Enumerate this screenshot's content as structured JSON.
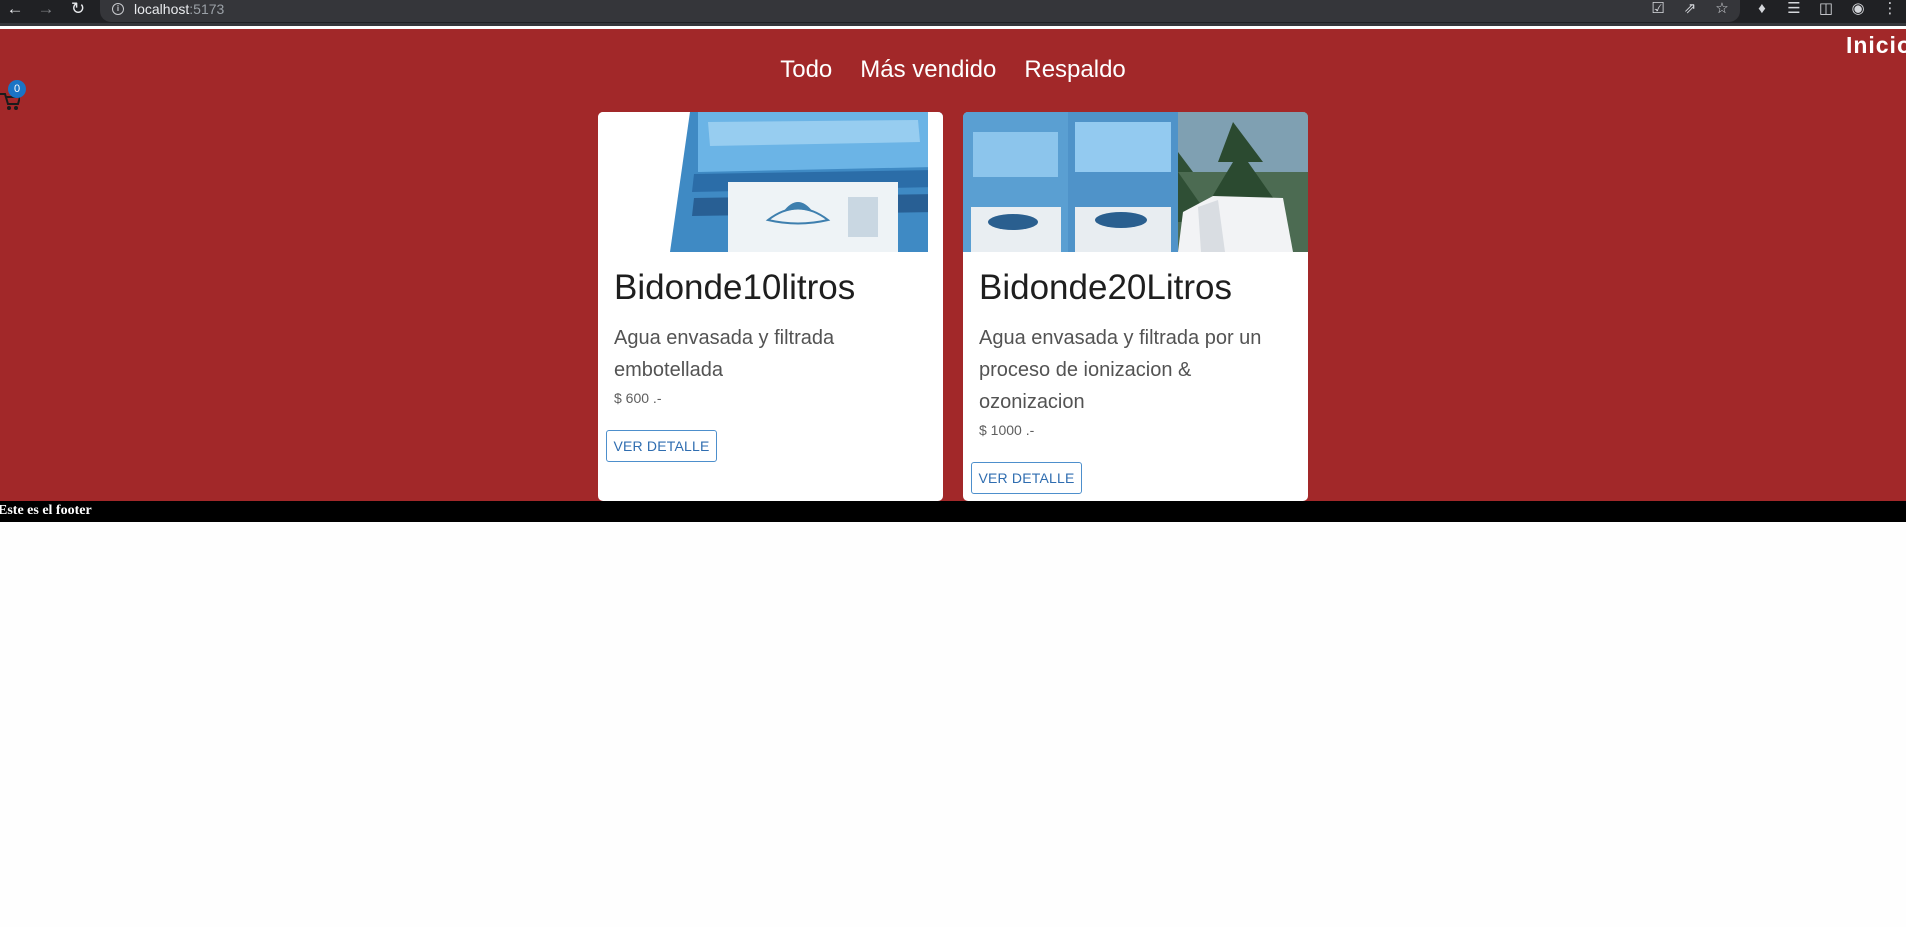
{
  "browser": {
    "url_host": "localhost",
    "url_port": ":5173",
    "back_icon": "arrow-left-icon",
    "forward_icon": "arrow-right-icon",
    "reload_icon": "reload-icon"
  },
  "header": {
    "inicio_label": "Inicio",
    "cart_count": "0"
  },
  "categories": [
    "Todo",
    "Más vendido",
    "Respaldo"
  ],
  "products": [
    {
      "title": "Bidonde10litros",
      "description": "Agua envasada y filtrada embotellada",
      "price": "$ 600 .-",
      "button_label": "VER DETALLE"
    },
    {
      "title": "Bidonde20Litros",
      "description": "Agua envasada y filtrada por un proceso de ionizacion & ozonizacion",
      "price": "$ 1000 .-",
      "button_label": "VER DETALLE"
    }
  ],
  "footer": {
    "text": "Este es el footer"
  },
  "colors": {
    "header_bg": "#a22829",
    "footer_bg": "#000000",
    "button_accent": "#2f6db0",
    "badge_blue": "#1a74c5"
  }
}
